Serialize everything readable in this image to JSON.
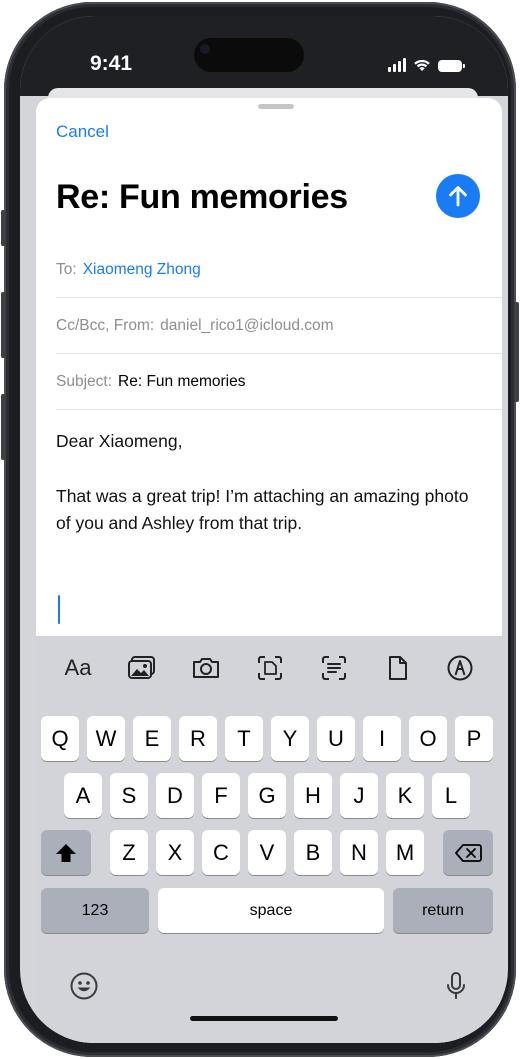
{
  "status_bar": {
    "time": "9:41"
  },
  "compose": {
    "cancel_label": "Cancel",
    "title": "Re: Fun memories",
    "to": {
      "label": "To:",
      "value": "Xiaomeng Zhong"
    },
    "cc_from": {
      "label": "Cc/Bcc, From:",
      "value": "daniel_rico1@icloud.com"
    },
    "subject": {
      "label": "Subject:",
      "value": "Re: Fun memories"
    },
    "body": {
      "greeting": "Dear Xiaomeng,",
      "paragraph": "That was a great trip! I’m attaching an amazing photo of you and Ashley from that trip."
    }
  },
  "keyboard_toolbar": {
    "format_label": "Aa",
    "icons": [
      "photo-library-icon",
      "camera-icon",
      "scan-document-icon",
      "scan-text-icon",
      "attach-file-icon",
      "markup-icon"
    ]
  },
  "keyboard": {
    "row1": [
      "Q",
      "W",
      "E",
      "R",
      "T",
      "Y",
      "U",
      "I",
      "O",
      "P"
    ],
    "row2": [
      "A",
      "S",
      "D",
      "F",
      "G",
      "H",
      "J",
      "K",
      "L"
    ],
    "row3": [
      "Z",
      "X",
      "C",
      "V",
      "B",
      "N",
      "M"
    ],
    "numbers_label": "123",
    "space_label": "space",
    "return_label": "return"
  },
  "colors": {
    "accent": "#1a7cf5"
  }
}
